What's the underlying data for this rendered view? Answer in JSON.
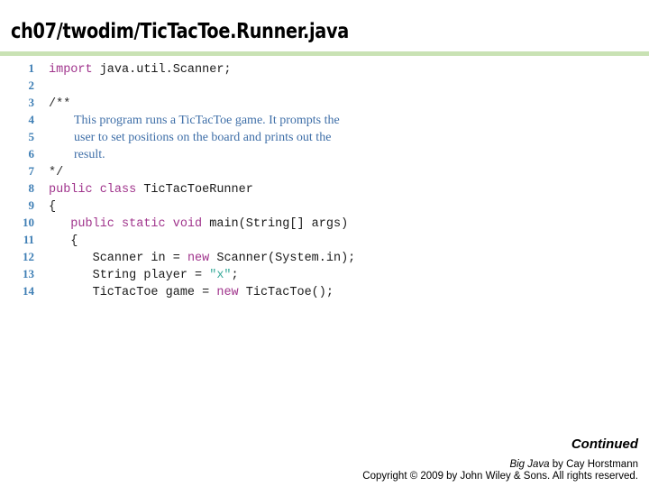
{
  "slide": {
    "title": "ch07/twodim/TicTacToe.Runner.java",
    "rule_color": "#c9e2b4"
  },
  "colors": {
    "line_number": "#3f7fb5",
    "keyword": "#a0348c",
    "string": "#3aab9b",
    "comment": "#3f6fa8",
    "code": "#1a1a1a",
    "rule": "#c9e2b4"
  },
  "code": {
    "lines": [
      {
        "n": "1",
        "kind": "code",
        "text": "import java.util.Scanner;",
        "keyword": "import",
        "rest": " java.util.Scanner;"
      },
      {
        "n": "2",
        "kind": "blank",
        "text": ""
      },
      {
        "n": "3",
        "kind": "comment_delim",
        "text": "/**"
      },
      {
        "n": "4",
        "kind": "comment",
        "text": "This program runs a TicTacToe game. It prompts the"
      },
      {
        "n": "5",
        "kind": "comment",
        "text": "user to set positions on the board and prints out the"
      },
      {
        "n": "6",
        "kind": "comment",
        "text": "result."
      },
      {
        "n": "7",
        "kind": "comment_delim",
        "text": "*/"
      },
      {
        "n": "8",
        "kind": "code",
        "text": "public class TicTacToeRunner",
        "keyword": "public class",
        "rest": " TicTacToeRunner"
      },
      {
        "n": "9",
        "kind": "code",
        "text": "{",
        "keyword": "",
        "rest": "{"
      },
      {
        "n": "10",
        "kind": "code",
        "text": "   public static void main(String[] args)",
        "keyword": "   public static void",
        "rest": " main(String[] args)"
      },
      {
        "n": "11",
        "kind": "code",
        "text": "   {",
        "keyword": "",
        "rest": "   {"
      },
      {
        "n": "12",
        "kind": "code",
        "text": "      Scanner in = new Scanner(System.in);",
        "keyword": "",
        "rest": "      Scanner in = new Scanner(System.in);"
      },
      {
        "n": "13",
        "kind": "code",
        "text": "      String player = \"x\";",
        "keyword": "",
        "rest": "      String player = \"x\";"
      },
      {
        "n": "14",
        "kind": "code",
        "text": "      TicTacToe game = new TicTacToe();",
        "keyword": "",
        "rest": "      TicTacToe game = new TicTacToe();"
      }
    ]
  },
  "footer": {
    "continued": "Continued",
    "book_title": "Big Java",
    "book_byline": " by  Cay Horstmann",
    "copyright": "Copyright © 2009 by John Wiley & Sons.  All rights reserved."
  }
}
